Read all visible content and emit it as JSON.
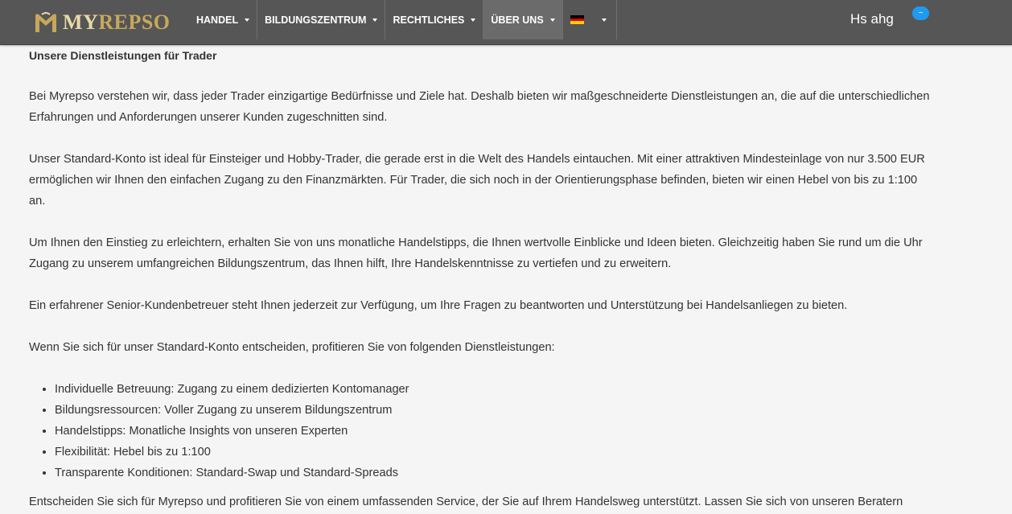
{
  "brand": {
    "logo_text_my": "MY",
    "logo_text_rest": "REPSO",
    "colors": {
      "gold": "#c7a85a",
      "navbar": "#565656",
      "badge": "#1e9bf0"
    }
  },
  "nav": {
    "items": [
      {
        "label": "HANDEL"
      },
      {
        "label": "BILDUNGSZENTRUM"
      },
      {
        "label": "RECHTLICHES"
      },
      {
        "label": "ÜBER UNS"
      }
    ],
    "language_icon": "german-flag-icon"
  },
  "user": {
    "name": "Hs ahg",
    "badge": "~"
  },
  "content": {
    "heading": "Unsere Dienstleistungen für Trader",
    "p1": "Bei Myrepso verstehen wir, dass jeder Trader einzigartige Bedürfnisse und Ziele hat. Deshalb bieten wir maßgeschneiderte Dienstleistungen an, die auf die unterschiedlichen Erfahrungen und Anforderungen unserer Kunden zugeschnitten sind.",
    "p2": "Unser Standard-Konto ist ideal für Einsteiger und Hobby-Trader, die gerade erst in die Welt des Handels eintauchen. Mit einer attraktiven Mindesteinlage von nur 3.500 EUR ermöglichen wir Ihnen den einfachen Zugang zu den Finanzmärkten. Für Trader, die sich noch in der Orientierungsphase befinden, bieten wir einen Hebel von bis zu 1:100 an.",
    "p3": "Um Ihnen den Einstieg zu erleichtern, erhalten Sie von uns monatliche Handelstipps, die Ihnen wertvolle Einblicke und Ideen bieten. Gleichzeitig haben Sie rund um die Uhr Zugang zu unserem umfangreichen Bildungszentrum, das Ihnen hilft, Ihre Handelskenntnisse zu vertiefen und zu erweitern.",
    "p4": "Ein erfahrener Senior-Kundenbetreuer steht Ihnen jederzeit zur Verfügung, um Ihre Fragen zu beantworten und Unterstützung bei Handelsanliegen zu bieten.",
    "p5": "Wenn Sie sich für unser Standard-Konto entscheiden, profitieren Sie von folgenden Dienstleistungen:",
    "list": [
      "Individuelle Betreuung: Zugang zu einem dedizierten Kontomanager",
      "Bildungsressourcen: Voller Zugang zu unserem Bildungszentrum",
      "Handelstipps: Monatliche Insights von unseren Experten",
      "Flexibilität: Hebel bis zu 1:100",
      "Transparente Konditionen: Standard-Swap und Standard-Spreads"
    ],
    "p6": "Entscheiden Sie sich für Myrepso und profitieren Sie von einem umfassenden Service, der Sie auf Ihrem Handelsweg unterstützt. Lassen Sie sich von unseren Beratern"
  }
}
